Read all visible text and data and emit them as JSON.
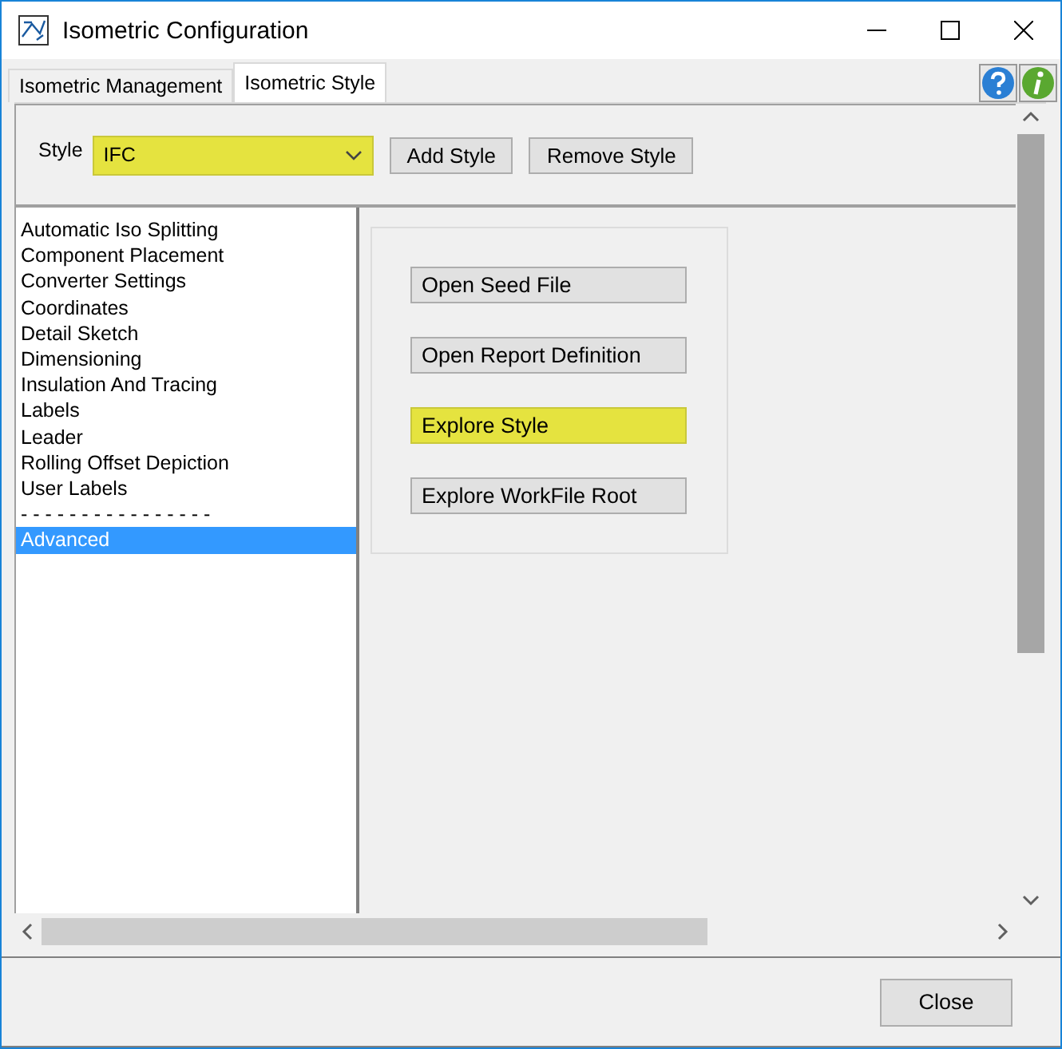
{
  "window": {
    "title": "Isometric Configuration"
  },
  "tabs": [
    {
      "label": "Isometric Management",
      "selected": false
    },
    {
      "label": "Isometric Style",
      "selected": true
    }
  ],
  "style_row": {
    "label": "Style",
    "combobox": {
      "value": "IFC",
      "highlighted": true
    },
    "buttons": [
      "Add Style",
      "Remove Style"
    ]
  },
  "categories": [
    {
      "label": "Automatic Iso Splitting",
      "selected": false
    },
    {
      "label": "Component Placement",
      "selected": false
    },
    {
      "label": "Converter Settings",
      "selected": false
    },
    {
      "label": "Coordinates",
      "selected": false
    },
    {
      "label": "Detail Sketch",
      "selected": false
    },
    {
      "label": "Dimensioning",
      "selected": false
    },
    {
      "label": "Insulation And Tracing",
      "selected": false
    },
    {
      "label": "Labels",
      "selected": false
    },
    {
      "label": "Leader",
      "selected": false
    },
    {
      "label": "Rolling Offset Depiction",
      "selected": false
    },
    {
      "label": "User Labels",
      "selected": false
    },
    {
      "label": "- - - - - - - - - - - - - - - -",
      "selected": false
    },
    {
      "label": "Advanced",
      "selected": true
    }
  ],
  "actions": [
    {
      "label": "Open Seed File",
      "highlighted": false
    },
    {
      "label": "Open Report Definition",
      "highlighted": false
    },
    {
      "label": "Explore Style",
      "highlighted": true
    },
    {
      "label": "Explore WorkFile Root",
      "highlighted": false
    }
  ],
  "footer": {
    "buttons": [
      "Close"
    ]
  }
}
